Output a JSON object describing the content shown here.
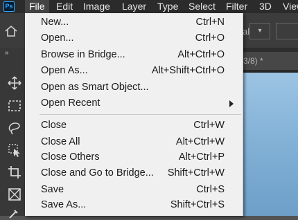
{
  "app": {
    "logo": "Ps"
  },
  "menubar": {
    "items": [
      "File",
      "Edit",
      "Image",
      "Layer",
      "Type",
      "Select",
      "Filter",
      "3D",
      "View"
    ]
  },
  "options_bar": {
    "partial_text": "al"
  },
  "toolbar": {
    "collapse_glyph": "»"
  },
  "document_tab": {
    "partial_title": "3/8) *"
  },
  "file_menu": {
    "group1": [
      {
        "label": "New...",
        "shortcut": "Ctrl+N"
      },
      {
        "label": "Open...",
        "shortcut": "Ctrl+O"
      },
      {
        "label": "Browse in Bridge...",
        "shortcut": "Alt+Ctrl+O"
      },
      {
        "label": "Open As...",
        "shortcut": "Alt+Shift+Ctrl+O"
      },
      {
        "label": "Open as Smart Object...",
        "shortcut": ""
      },
      {
        "label": "Open Recent",
        "shortcut": "",
        "submenu": true
      }
    ],
    "group2": [
      {
        "label": "Close",
        "shortcut": "Ctrl+W"
      },
      {
        "label": "Close All",
        "shortcut": "Alt+Ctrl+W"
      },
      {
        "label": "Close Others",
        "shortcut": "Alt+Ctrl+P"
      },
      {
        "label": "Close and Go to Bridge...",
        "shortcut": "Shift+Ctrl+W"
      },
      {
        "label": "Save",
        "shortcut": "Ctrl+S"
      },
      {
        "label": "Save As...",
        "shortcut": "Shift+Ctrl+S"
      }
    ]
  }
}
